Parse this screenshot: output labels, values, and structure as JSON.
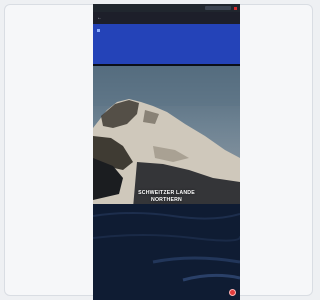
{
  "topbar": {
    "brand": "",
    "links": [
      "",
      "",
      ""
    ]
  },
  "toolbar": {
    "text": ""
  },
  "panel": {
    "col1": {
      "heading": "",
      "lines": [
        "",
        ""
      ]
    },
    "col2": {
      "lines": [
        "",
        "",
        "",
        "",
        "",
        "",
        "",
        ""
      ]
    },
    "col3": {
      "lines": [
        "",
        ""
      ]
    }
  },
  "hero": {
    "title_line1": "SCHWEITZER LANDE",
    "title_line2": "NORTHERN"
  },
  "colors": {
    "panel": "#2443b8",
    "topbar": "#20262e",
    "record": "#e23b3b"
  }
}
